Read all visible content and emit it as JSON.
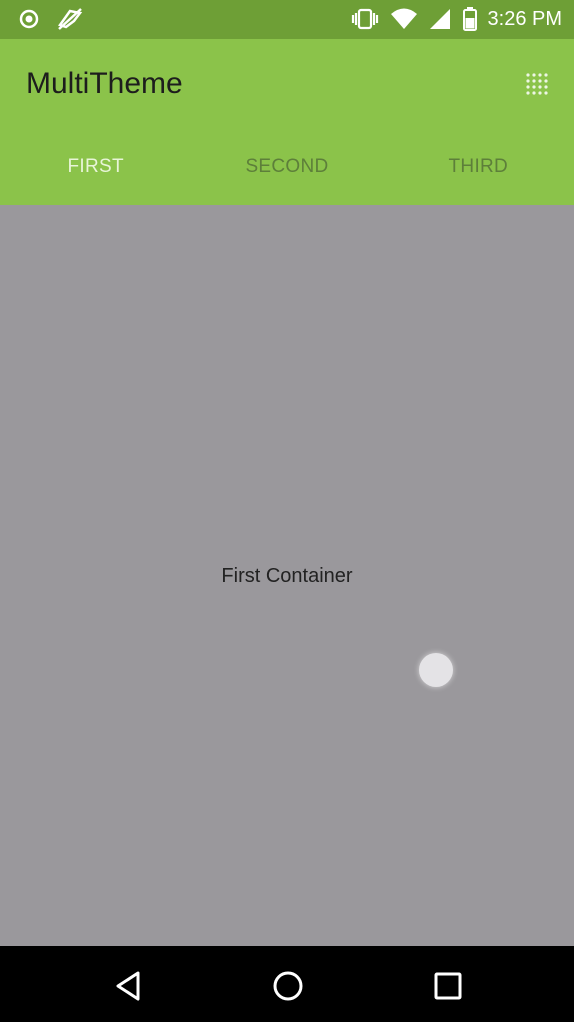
{
  "status_bar": {
    "time": "3:26 PM",
    "icons": [
      "record-icon",
      "no-sync-icon",
      "vibrate-icon",
      "wifi-icon",
      "signal-icon",
      "battery-icon"
    ]
  },
  "app": {
    "title": "MultiTheme",
    "toolbar_color": "#8bc34a",
    "status_bar_color": "#6e9f36",
    "menu_icon": "grid-dots-icon"
  },
  "tabs": [
    {
      "label": "FIRST",
      "active": true
    },
    {
      "label": "SECOND",
      "active": false
    },
    {
      "label": "THIRD",
      "active": false
    }
  ],
  "main": {
    "container_text": "First Container",
    "background_color": "#9a989c"
  },
  "nav_bar": {
    "icons": [
      "back-icon",
      "home-icon",
      "recents-icon"
    ]
  }
}
